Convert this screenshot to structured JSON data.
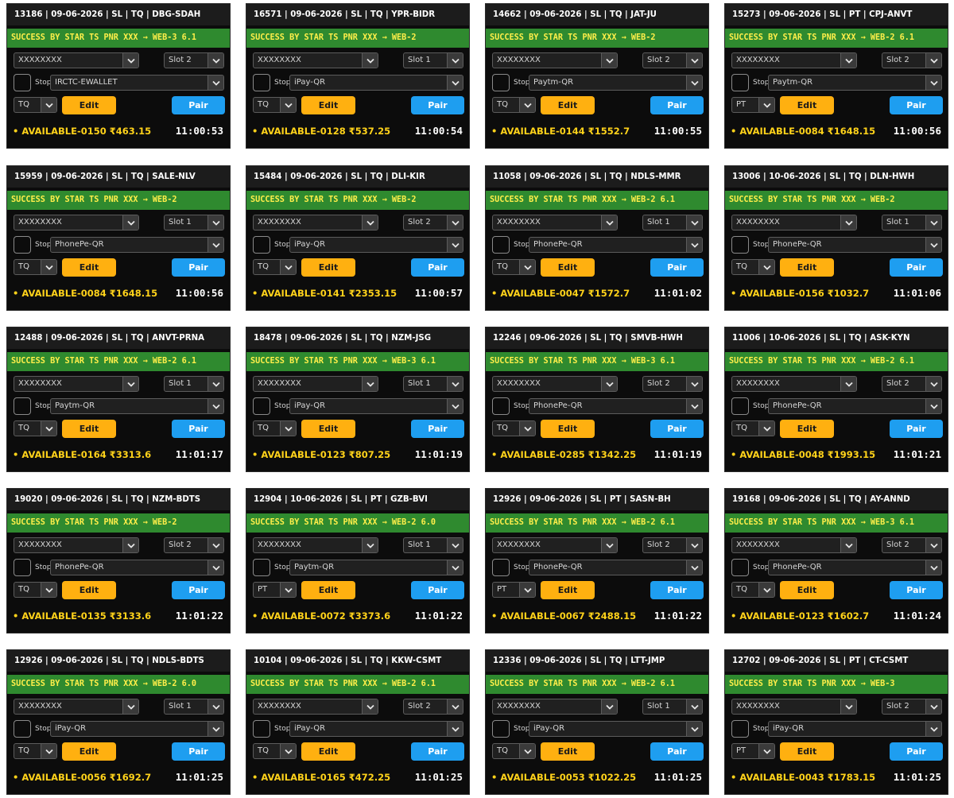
{
  "cards": [
    {
      "header": "13186 | 09-06-2026 | SL | TQ | DBG-SDAH",
      "status": "SUCCESS BY STAR TS PNR XXX → WEB-3 6.1",
      "account": "XXXXXXXX",
      "slot": "Slot 2",
      "stop_label": "Stop",
      "payment": "IRCTC-EWALLET",
      "quota": "TQ",
      "edit_label": "Edit",
      "pair_label": "Pair",
      "availability": "• AVAILABLE-0150 ₹463.15",
      "time": "11:00:53"
    },
    {
      "header": "16571 | 09-06-2026 | SL | TQ | YPR-BIDR",
      "status": "SUCCESS BY STAR TS PNR XXX → WEB-2",
      "account": "XXXXXXXX",
      "slot": "Slot 1",
      "stop_label": "Stop",
      "payment": "iPay-QR",
      "quota": "TQ",
      "edit_label": "Edit",
      "pair_label": "Pair",
      "availability": "• AVAILABLE-0128 ₹537.25",
      "time": "11:00:54"
    },
    {
      "header": "14662 | 09-06-2026 | SL | TQ | JAT-JU",
      "status": "SUCCESS BY STAR TS PNR XXX → WEB-2",
      "account": "XXXXXXXX",
      "slot": "Slot 2",
      "stop_label": "Stop",
      "payment": "Paytm-QR",
      "quota": "TQ",
      "edit_label": "Edit",
      "pair_label": "Pair",
      "availability": "• AVAILABLE-0144 ₹1552.7",
      "time": "11:00:55"
    },
    {
      "header": "15273 | 09-06-2026 | SL | PT | CPJ-ANVT",
      "status": "SUCCESS BY STAR TS PNR XXX → WEB-2 6.1",
      "account": "XXXXXXXX",
      "slot": "Slot 2",
      "stop_label": "Stop",
      "payment": "Paytm-QR",
      "quota": "PT",
      "edit_label": "Edit",
      "pair_label": "Pair",
      "availability": "• AVAILABLE-0084 ₹1648.15",
      "time": "11:00:56"
    },
    {
      "header": "15959 | 09-06-2026 | SL | TQ | SALE-NLV",
      "status": "SUCCESS BY STAR TS PNR XXX → WEB-2",
      "account": "XXXXXXXX",
      "slot": "Slot 1",
      "stop_label": "Stop",
      "payment": "PhonePe-QR",
      "quota": "TQ",
      "edit_label": "Edit",
      "pair_label": "Pair",
      "availability": "• AVAILABLE-0084 ₹1648.15",
      "time": "11:00:56"
    },
    {
      "header": "15484 | 09-06-2026 | SL | TQ | DLI-KIR",
      "status": "SUCCESS BY STAR TS PNR XXX → WEB-2",
      "account": "XXXXXXXX",
      "slot": "Slot 2",
      "stop_label": "Stop",
      "payment": "iPay-QR",
      "quota": "TQ",
      "edit_label": "Edit",
      "pair_label": "Pair",
      "availability": "• AVAILABLE-0141 ₹2353.15",
      "time": "11:00:57"
    },
    {
      "header": "11058 | 09-06-2026 | SL | TQ | NDLS-MMR",
      "status": "SUCCESS BY STAR TS PNR XXX → WEB-2 6.1",
      "account": "XXXXXXXX",
      "slot": "Slot 1",
      "stop_label": "Stop",
      "payment": "PhonePe-QR",
      "quota": "TQ",
      "edit_label": "Edit",
      "pair_label": "Pair",
      "availability": "• AVAILABLE-0047 ₹1572.7",
      "time": "11:01:02"
    },
    {
      "header": "13006 | 10-06-2026 | SL | TQ | DLN-HWH",
      "status": "SUCCESS BY STAR TS PNR XXX → WEB-2",
      "account": "XXXXXXXX",
      "slot": "Slot 1",
      "stop_label": "Stop",
      "payment": "PhonePe-QR",
      "quota": "TQ",
      "edit_label": "Edit",
      "pair_label": "Pair",
      "availability": "• AVAILABLE-0156 ₹1032.7",
      "time": "11:01:06"
    },
    {
      "header": "12488 | 09-06-2026 | SL | TQ | ANVT-PRNA",
      "status": "SUCCESS BY STAR TS PNR XXX → WEB-2 6.1",
      "account": "XXXXXXXX",
      "slot": "Slot 1",
      "stop_label": "Stop",
      "payment": "Paytm-QR",
      "quota": "TQ",
      "edit_label": "Edit",
      "pair_label": "Pair",
      "availability": "• AVAILABLE-0164 ₹3313.6",
      "time": "11:01:17"
    },
    {
      "header": "18478 | 09-06-2026 | SL | TQ | NZM-JSG",
      "status": "SUCCESS BY STAR TS PNR XXX → WEB-3 6.1",
      "account": "XXXXXXXX",
      "slot": "Slot 1",
      "stop_label": "Stop",
      "payment": "iPay-QR",
      "quota": "TQ",
      "edit_label": "Edit",
      "pair_label": "Pair",
      "availability": "• AVAILABLE-0123 ₹807.25",
      "time": "11:01:19"
    },
    {
      "header": "12246 | 09-06-2026 | SL | TQ | SMVB-HWH",
      "status": "SUCCESS BY STAR TS PNR XXX → WEB-3 6.1",
      "account": "XXXXXXXX",
      "slot": "Slot 2",
      "stop_label": "Stop",
      "payment": "PhonePe-QR",
      "quota": "TQ",
      "edit_label": "Edit",
      "pair_label": "Pair",
      "availability": "• AVAILABLE-0285 ₹1342.25",
      "time": "11:01:19"
    },
    {
      "header": "11006 | 10-06-2026 | SL | TQ | ASK-KYN",
      "status": "SUCCESS BY STAR TS PNR XXX → WEB-2 6.1",
      "account": "XXXXXXXX",
      "slot": "Slot 2",
      "stop_label": "Stop",
      "payment": "PhonePe-QR",
      "quota": "TQ",
      "edit_label": "Edit",
      "pair_label": "Pair",
      "availability": "• AVAILABLE-0048 ₹1993.15",
      "time": "11:01:21"
    },
    {
      "header": "19020 | 09-06-2026 | SL | TQ | NZM-BDTS",
      "status": "SUCCESS BY STAR TS PNR XXX → WEB-2",
      "account": "XXXXXXXX",
      "slot": "Slot 2",
      "stop_label": "Stop",
      "payment": "PhonePe-QR",
      "quota": "TQ",
      "edit_label": "Edit",
      "pair_label": "Pair",
      "availability": "• AVAILABLE-0135 ₹3133.6",
      "time": "11:01:22"
    },
    {
      "header": "12904 | 10-06-2026 | SL | PT | GZB-BVI",
      "status": "SUCCESS BY STAR TS PNR XXX → WEB-2 6.0",
      "account": "XXXXXXXX",
      "slot": "Slot 1",
      "stop_label": "Stop",
      "payment": "Paytm-QR",
      "quota": "PT",
      "edit_label": "Edit",
      "pair_label": "Pair",
      "availability": "• AVAILABLE-0072 ₹3373.6",
      "time": "11:01:22"
    },
    {
      "header": "12926 | 09-06-2026 | SL | PT | SASN-BH",
      "status": "SUCCESS BY STAR TS PNR XXX → WEB-2 6.1",
      "account": "XXXXXXXX",
      "slot": "Slot 2",
      "stop_label": "Stop",
      "payment": "PhonePe-QR",
      "quota": "PT",
      "edit_label": "Edit",
      "pair_label": "Pair",
      "availability": "• AVAILABLE-0067 ₹2488.15",
      "time": "11:01:22"
    },
    {
      "header": "19168 | 09-06-2026 | SL | TQ | AY-ANND",
      "status": "SUCCESS BY STAR TS PNR XXX → WEB-3 6.1",
      "account": "XXXXXXXX",
      "slot": "Slot 2",
      "stop_label": "Stop",
      "payment": "PhonePe-QR",
      "quota": "TQ",
      "edit_label": "Edit",
      "pair_label": "Pair",
      "availability": "• AVAILABLE-0123 ₹1602.7",
      "time": "11:01:24"
    },
    {
      "header": "12926 | 09-06-2026 | SL | TQ | NDLS-BDTS",
      "status": "SUCCESS BY STAR TS PNR XXX → WEB-2 6.0",
      "account": "XXXXXXXX",
      "slot": "Slot 1",
      "stop_label": "Stop",
      "payment": "iPay-QR",
      "quota": "TQ",
      "edit_label": "Edit",
      "pair_label": "Pair",
      "availability": "• AVAILABLE-0056 ₹1692.7",
      "time": "11:01:25"
    },
    {
      "header": "10104 | 09-06-2026 | SL | TQ | KKW-CSMT",
      "status": "SUCCESS BY STAR TS PNR XXX → WEB-2 6.1",
      "account": "XXXXXXXX",
      "slot": "Slot 2",
      "stop_label": "Stop",
      "payment": "iPay-QR",
      "quota": "TQ",
      "edit_label": "Edit",
      "pair_label": "Pair",
      "availability": "• AVAILABLE-0165 ₹472.25",
      "time": "11:01:25"
    },
    {
      "header": "12336 | 09-06-2026 | SL | TQ | LTT-JMP",
      "status": "SUCCESS BY STAR TS PNR XXX → WEB-2 6.1",
      "account": "XXXXXXXX",
      "slot": "Slot 1",
      "stop_label": "Stop",
      "payment": "iPay-QR",
      "quota": "TQ",
      "edit_label": "Edit",
      "pair_label": "Pair",
      "availability": "• AVAILABLE-0053 ₹1022.25",
      "time": "11:01:25"
    },
    {
      "header": "12702 | 09-06-2026 | SL | PT | CT-CSMT",
      "status": "SUCCESS BY STAR TS PNR XXX → WEB-3",
      "account": "XXXXXXXX",
      "slot": "Slot 2",
      "stop_label": "Stop",
      "payment": "iPay-QR",
      "quota": "PT",
      "edit_label": "Edit",
      "pair_label": "Pair",
      "availability": "• AVAILABLE-0043 ₹1783.15",
      "time": "11:01:25"
    }
  ],
  "icons": {
    "dropdown": "chevron-down-icon"
  },
  "colors": {
    "card_bg": "#0c0c0c",
    "status_bg": "#2f8a2f",
    "status_text": "#ffef4a",
    "edit_button": "#ffb010",
    "pair_button": "#1e9ef0",
    "availability_text": "#ffd21a"
  }
}
